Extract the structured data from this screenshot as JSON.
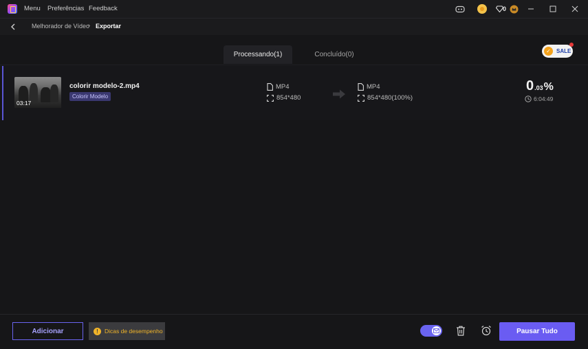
{
  "titlebar": {
    "menu": [
      "Menu",
      "Preferências",
      "Feedback"
    ],
    "gems_count": "0"
  },
  "breadcrumb": {
    "parent": "Melhorador de Vídeo",
    "current": "Exportar"
  },
  "tabs": [
    {
      "label": "Processando(1)",
      "active": true
    },
    {
      "label": "Concluído(0)",
      "active": false
    }
  ],
  "sale_label": "SALE",
  "task": {
    "thumbnail_time": "03:17",
    "file_name": "colorir modelo-2.mp4",
    "model_tag": "Colorir Modelo",
    "source": {
      "format": "MP4",
      "resolution": "854*480"
    },
    "target": {
      "format": "MP4",
      "resolution": "854*480(100%)"
    },
    "progress_int": "0",
    "progress_dec": ".03",
    "progress_sign": "%",
    "eta": "6:04:49"
  },
  "bottom": {
    "add_label": "Adicionar",
    "tips_label": "Dicas de desempenho",
    "pause_label": "Pausar Tudo",
    "notify_toggle_on": true
  },
  "colors": {
    "accent": "#6a5cf2",
    "tips": "#f0b429",
    "background": "#161618"
  }
}
